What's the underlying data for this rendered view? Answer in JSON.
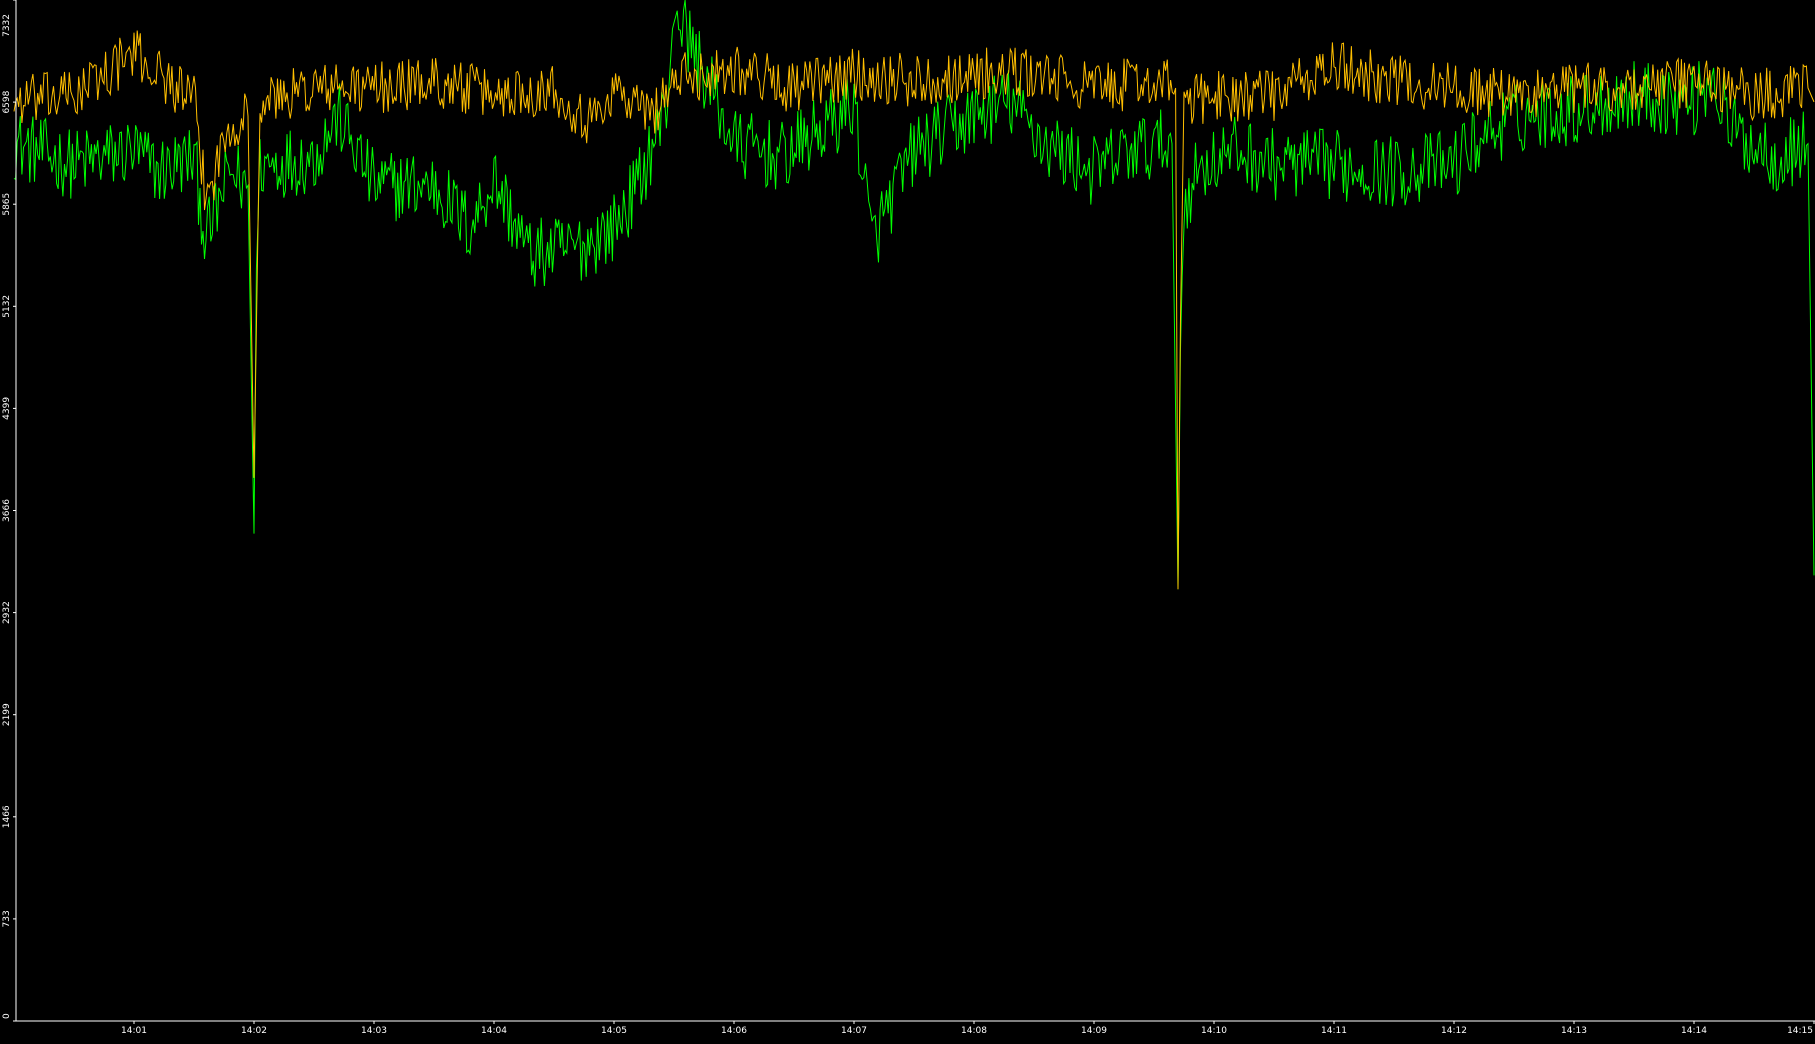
{
  "chart_data": {
    "type": "line",
    "title": "",
    "xlabel": "",
    "ylabel": "",
    "ylim": [
      0,
      7332
    ],
    "y_ticks": [
      "0",
      "733",
      "1466",
      "2199",
      "2932",
      "3666",
      "4399",
      "5132",
      "5865",
      "6598",
      "7332"
    ],
    "x_ticks": [
      "14:01",
      "14:02",
      "14:03",
      "14:04",
      "14:05",
      "14:06",
      "14:07",
      "14:08",
      "14:09",
      "14:10",
      "14:11",
      "14:12",
      "14:13",
      "14:14",
      "14:15"
    ],
    "grid": false,
    "legend": "none",
    "series": [
      {
        "color": "#00ff00",
        "x_minutes": [
          0.0,
          0.5,
          1.0,
          1.2,
          1.5,
          1.6,
          1.8,
          1.95,
          2.0,
          2.02,
          2.05,
          2.5,
          2.7,
          3.0,
          3.5,
          3.8,
          4.0,
          4.3,
          4.7,
          5.0,
          5.2,
          5.45,
          5.5,
          6.0,
          6.4,
          6.9,
          7.0,
          7.15,
          7.5,
          8.0,
          8.3,
          8.6,
          9.0,
          9.3,
          9.65,
          9.7,
          9.72,
          9.75,
          9.9,
          10.2,
          10.5,
          11.0,
          11.5,
          12.0,
          12.1,
          12.3,
          12.6,
          13.0,
          13.5,
          14.0,
          14.15,
          14.3,
          14.7,
          14.95,
          15.0
        ],
        "values": [
          6300,
          6150,
          6250,
          6100,
          6200,
          5600,
          6100,
          6000,
          3500,
          5400,
          6150,
          6200,
          6500,
          6000,
          6000,
          5700,
          6050,
          5500,
          5550,
          5700,
          6000,
          6600,
          7300,
          6300,
          6200,
          6500,
          6600,
          5600,
          6250,
          6500,
          6600,
          6300,
          6100,
          6250,
          6300,
          3100,
          4800,
          5900,
          6150,
          6250,
          6150,
          6150,
          6100,
          6150,
          6250,
          6400,
          6500,
          6550,
          6650,
          6600,
          6800,
          6400,
          6200,
          6300,
          3200
        ]
      },
      {
        "color": "#ffbf00",
        "x_minutes": [
          0.0,
          0.5,
          1.0,
          1.5,
          1.6,
          1.8,
          1.95,
          2.0,
          2.05,
          2.5,
          3.0,
          3.5,
          4.0,
          4.5,
          4.8,
          5.0,
          5.3,
          5.5,
          6.0,
          6.5,
          7.0,
          7.5,
          8.0,
          8.5,
          9.0,
          9.5,
          9.68,
          9.7,
          9.72,
          9.75,
          10.0,
          10.5,
          11.0,
          11.5,
          12.0,
          12.5,
          13.0,
          13.5,
          14.0,
          14.5,
          14.95,
          15.0
        ],
        "values": [
          6600,
          6650,
          6950,
          6600,
          5900,
          6450,
          6500,
          3900,
          6600,
          6700,
          6700,
          6750,
          6650,
          6700,
          6450,
          6700,
          6500,
          6750,
          6850,
          6700,
          6800,
          6750,
          6800,
          6800,
          6700,
          6750,
          6700,
          3100,
          5000,
          6600,
          6650,
          6650,
          6850,
          6750,
          6700,
          6650,
          6700,
          6700,
          6750,
          6650,
          6700,
          6600
        ]
      }
    ]
  }
}
